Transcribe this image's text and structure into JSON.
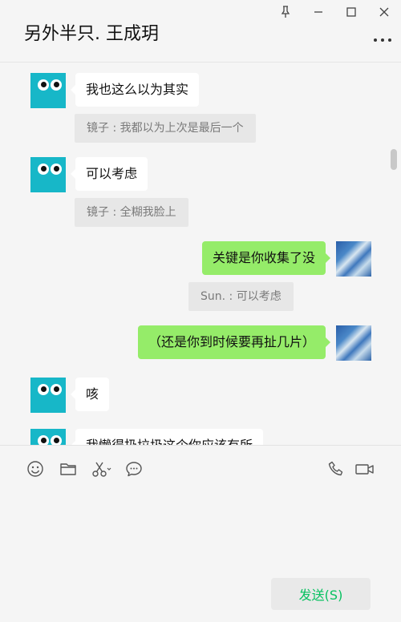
{
  "window": {
    "title": "另外半只. 王成玥",
    "controls": [
      "pin-icon",
      "minimize-icon",
      "maximize-icon",
      "close-icon"
    ]
  },
  "messages": [
    {
      "side": "left",
      "text": "我也这么以为其实",
      "quote": "镜子 : 我都以为上次是最后一个"
    },
    {
      "side": "left",
      "text": "可以考虑",
      "quote": "镜子 : 全糊我脸上"
    },
    {
      "side": "right",
      "text": "关键是你收集了没",
      "quote": "Sun. : 可以考虑"
    },
    {
      "side": "right",
      "text": "（还是你到时候要再扯几片）"
    },
    {
      "side": "left",
      "text": "咳"
    },
    {
      "side": "left",
      "text": "我懒得扔垃圾这个你应该有所"
    }
  ],
  "toolbar": {
    "icons": [
      "emoji-icon",
      "folder-icon",
      "scissors-icon",
      "chat-history-icon",
      "phone-icon",
      "video-icon"
    ]
  },
  "input": {
    "value": ""
  },
  "send": {
    "label": "发送(S)"
  },
  "colors": {
    "accent": "#07c160",
    "bubble_self": "#95ec69",
    "avatar_bot": "#17b7c8"
  }
}
